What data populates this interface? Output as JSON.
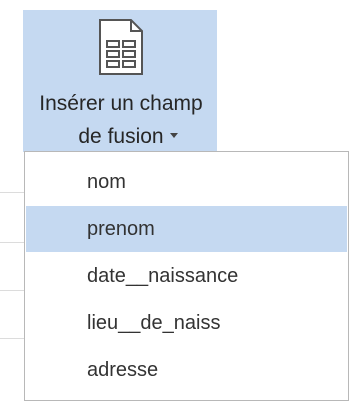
{
  "ribbon_button": {
    "label_line1": "Insérer un champ",
    "label_line2": "de fusion",
    "icon": "merge-field-document-icon",
    "dropdown_icon": "chevron-down-icon"
  },
  "menu": {
    "items": [
      {
        "label": "nom",
        "selected": false
      },
      {
        "label": "prenom",
        "selected": true
      },
      {
        "label": "date__naissance",
        "selected": false
      },
      {
        "label": "lieu__de_naiss",
        "selected": false
      },
      {
        "label": "adresse",
        "selected": false
      }
    ]
  },
  "colors": {
    "highlight": "#c5d9f1",
    "menu_border": "#b8b8b8",
    "text": "#262626"
  }
}
